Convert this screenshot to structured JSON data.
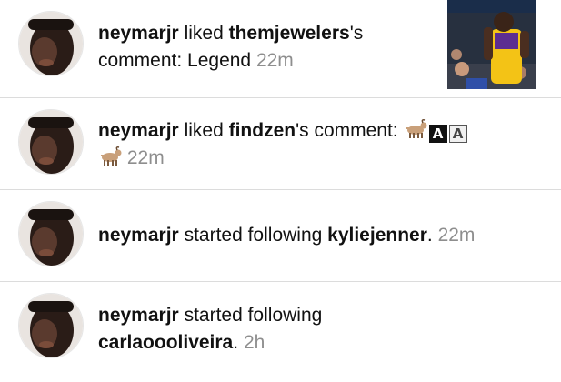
{
  "notifications": [
    {
      "user": "neymarjr",
      "action": "liked",
      "target": "themjewelers",
      "suffix": "'s",
      "suffix2": "comment: Legend",
      "time": "22m"
    },
    {
      "user": "neymarjr",
      "action": "liked",
      "target": "findzen",
      "suffix": "'s comment:",
      "letter_a": "A",
      "letter_b": "A",
      "time": "22m"
    },
    {
      "user": "neymarjr",
      "action": "started following",
      "target": "kyliejenner",
      "suffix": ".",
      "time": "22m"
    },
    {
      "user": "neymarjr",
      "action": "started following",
      "target": "carlaoooliveira",
      "suffix": ".",
      "time": "2h"
    }
  ],
  "icons": {
    "goat": "goat-emoji",
    "letter_dark": "negative-squared-letter-a",
    "letter_light": "squared-letter-a"
  },
  "colors": {
    "text": "#111111",
    "timestamp": "#8e8e8e",
    "divider": "#dcdcdc"
  }
}
